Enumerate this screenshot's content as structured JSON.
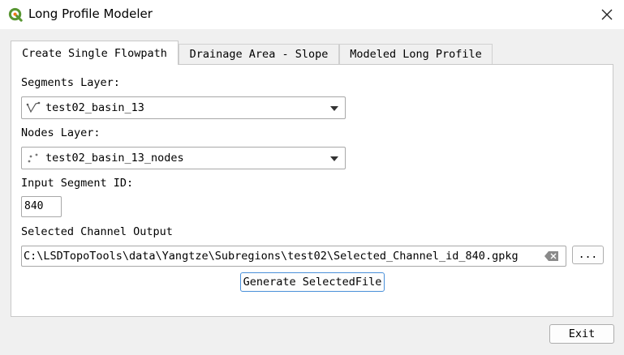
{
  "window": {
    "title": "Long Profile Modeler",
    "app_icon": "qgis-icon",
    "close_icon": "close-icon"
  },
  "tabs": [
    {
      "label": "Create Single Flowpath",
      "active": true
    },
    {
      "label": "Drainage Area - Slope",
      "active": false
    },
    {
      "label": "Modeled Long Profile",
      "active": false
    }
  ],
  "form": {
    "segments_label": "Segments Layer:",
    "segments_value": "test02_basin_13",
    "segments_icon": "line-layer-icon",
    "nodes_label": "Nodes Layer:",
    "nodes_value": "test02_basin_13_nodes",
    "nodes_icon": "point-layer-icon",
    "segment_id_label": "Input Segment ID:",
    "segment_id_value": "840",
    "output_label": "Selected Channel Output",
    "output_value": "C:\\LSDTopoTools\\data\\Yangtze\\Subregions\\test02\\Selected_Channel_id_840.gpkg",
    "browse_label": "...",
    "generate_label": "Generate SelectedFile"
  },
  "footer": {
    "exit_label": "Exit"
  }
}
